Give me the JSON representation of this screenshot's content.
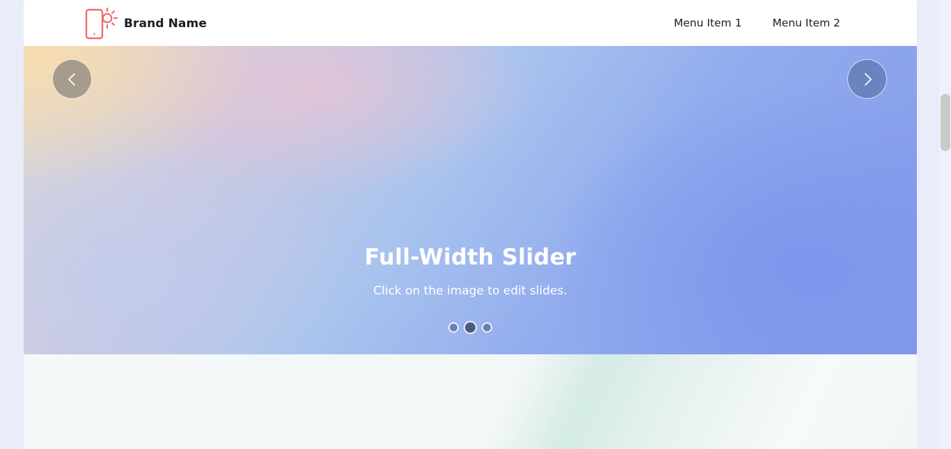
{
  "navbar": {
    "brand_name": "Brand Name",
    "logo_icon": "phone-sun-icon",
    "menu": [
      "Menu Item 1",
      "Menu Item 2"
    ]
  },
  "slider": {
    "title": "Full-Width Slider",
    "subtitle": "Click on the image to edit slides.",
    "prev_icon": "chevron-left-icon",
    "next_icon": "chevron-right-icon",
    "slide_count": 3,
    "active_slide": 2
  },
  "colors": {
    "brand_accent": "#f06b6b",
    "text": "#1c1c1c",
    "caption": "#ffffff"
  }
}
